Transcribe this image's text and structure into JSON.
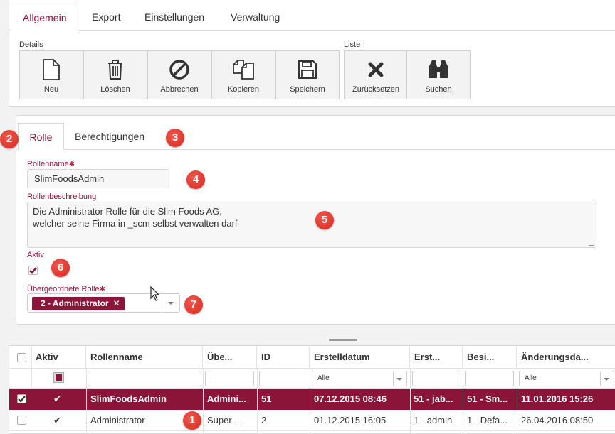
{
  "top_tabs": [
    "Allgemein",
    "Export",
    "Einstellungen",
    "Verwaltung"
  ],
  "toolbar": {
    "group_details": "Details",
    "group_liste": "Liste",
    "buttons": [
      "Neu",
      "Löschen",
      "Abbrechen",
      "Kopieren",
      "Speichern",
      "Zurücksetzen",
      "Suchen"
    ]
  },
  "role_tabs": [
    "Rolle",
    "Berechtigungen"
  ],
  "form": {
    "rolename_label": "Rollenname",
    "required_mark": "✱",
    "rolename_value": "SlimFoodsAdmin",
    "description_label": "Rollenbeschreibung",
    "description_value": "Die Administrator Rolle für die Slim Foods AG,\nwelcher seine Firma in _scm selbst verwalten darf",
    "active_label": "Aktiv",
    "active_checked": true,
    "parent_label": "Übergeordnete Rolle",
    "parent_value": "2 - Administrator",
    "parent_remove": "✕"
  },
  "badges": [
    "1",
    "2",
    "3",
    "4",
    "5",
    "6",
    "7"
  ],
  "grid": {
    "headers": [
      "Aktiv",
      "Rollenname",
      "Übe...",
      "ID",
      "Erstelldatum",
      "Erst...",
      "Besi...",
      "Änderungsda..."
    ],
    "filter_all": "Alle",
    "rows": [
      {
        "selected": true,
        "active": "✔",
        "name": "SlimFoodsAdmin",
        "parent": "Admini...",
        "id": "51",
        "created": "07.12.2015 08:46",
        "creator": "51 - jab...",
        "owner": "51 - Sm...",
        "changed": "11.01.2016 15:26"
      },
      {
        "selected": false,
        "active": "✔",
        "name": "Administrator",
        "parent": "Super ...",
        "id": "2",
        "created": "01.12.2015 16:05",
        "creator": "1 - admin",
        "owner": "1 - Defa...",
        "changed": "26.04.2016 08:50"
      }
    ]
  },
  "colors": {
    "accent": "#8a1538",
    "badge": "#e0362c"
  }
}
